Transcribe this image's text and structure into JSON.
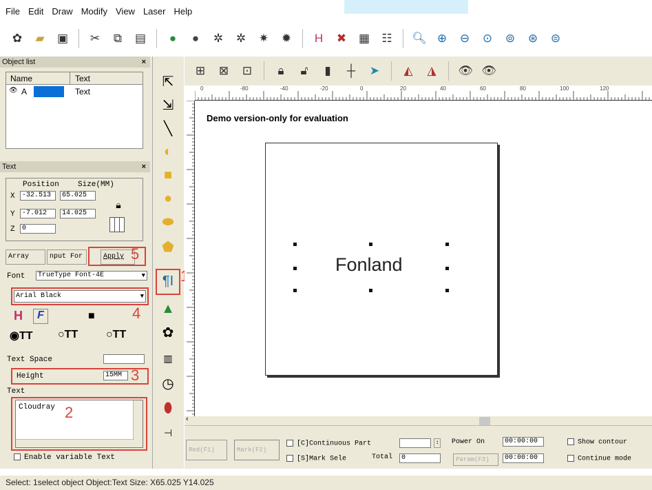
{
  "menu": [
    "File",
    "Edit",
    "Draw",
    "Modify",
    "View",
    "Laser",
    "Help"
  ],
  "object_list": {
    "title": "Object list",
    "col_name": "Name",
    "col_type": "Text",
    "row_name": "A",
    "row_type": "Text"
  },
  "text_panel": {
    "title": "Text",
    "position_label": "Position",
    "size_label": "Size(MM)",
    "x_label": "X",
    "y_label": "Y",
    "z_label": "Z",
    "x_pos": "-32.513",
    "x_size": "65.025",
    "y_pos": "-7.012",
    "y_size": "14.025",
    "z_pos": "0",
    "array_btn": "Array",
    "input_btn": "nput For",
    "apply_btn": "Apply",
    "font_label": "Font",
    "font_type": "TrueType Font-4E",
    "font_name": "Arial Black",
    "text_space_label": "Text Space",
    "height_label": "Height",
    "height_value": "15MM",
    "text_label": "Text",
    "text_value": "Cloudray",
    "enable_variable": "Enable variable Text"
  },
  "annotations": {
    "n1": "1",
    "n2": "2",
    "n3": "3",
    "n4": "4",
    "n5": "5"
  },
  "canvas": {
    "watermark": "Demo version-only for evaluation",
    "object_text": "Fonland"
  },
  "ruler_top": [
    "0",
    "-80",
    "-40",
    "-20",
    "0",
    "20",
    "40",
    "60",
    "80",
    "100",
    "120"
  ],
  "bottom": {
    "red_btn": "Red(F1)",
    "mark_btn": "Mark(F2)",
    "continuous": "[C]Continuous Part",
    "mark_sele": "[S]Mark Sele",
    "total_label": "Total",
    "total_value": "0",
    "power_on": "Power On",
    "time1": "00:00:00",
    "param_btn": "Param(F3)",
    "time2": "00:00:00",
    "show_contour": "Show contour",
    "continue_mode": "Continue mode"
  },
  "status": "Select: 1select object Object:Text Size: X65.025 Y14.025",
  "accent": "#d9433c"
}
